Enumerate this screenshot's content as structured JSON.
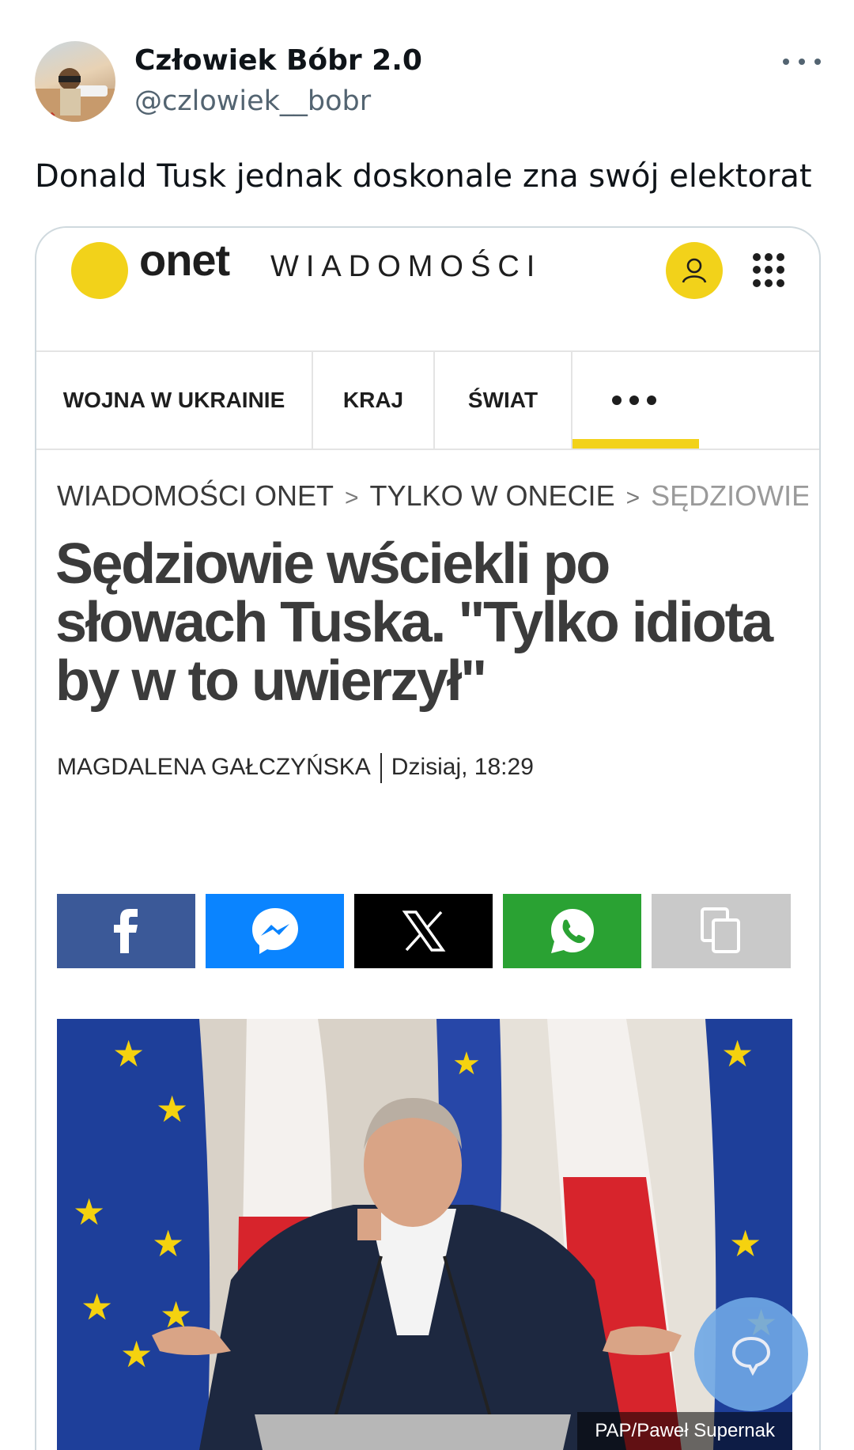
{
  "tweet": {
    "display_name": "Człowiek Bóbr 2.0",
    "handle": "@czlowiek__bobr",
    "text": "Donald Tusk jednak doskonale zna swój elektorat"
  },
  "article": {
    "brand": "onet",
    "section": "WIADOMOŚCI",
    "nav": [
      "WOJNA W UKRAINIE",
      "KRAJ",
      "ŚWIAT"
    ],
    "breadcrumbs": [
      "WIADOMOŚCI ONET",
      "TYLKO W ONECIE",
      "SĘDZIOWIE W"
    ],
    "breadcrumb_separator": ">",
    "headline": "Sędziowie wściekli po słowach Tuska. \"Tylko idiota by w to uwierzył\"",
    "author": "MAGDALENA GAŁCZYŃSKA",
    "date": "Dzisiaj, 18:29",
    "photo_credit": "PAP/Paweł Supernak"
  },
  "share": [
    {
      "name": "facebook",
      "color": "#3b5998"
    },
    {
      "name": "messenger",
      "color": "#0a84ff"
    },
    {
      "name": "x",
      "color": "#000000"
    },
    {
      "name": "whatsapp",
      "color": "#2aa233"
    },
    {
      "name": "copy",
      "color": "#c9c9c9"
    }
  ],
  "colors": {
    "accent": "#f2d21a",
    "handle_gray": "#536471"
  }
}
